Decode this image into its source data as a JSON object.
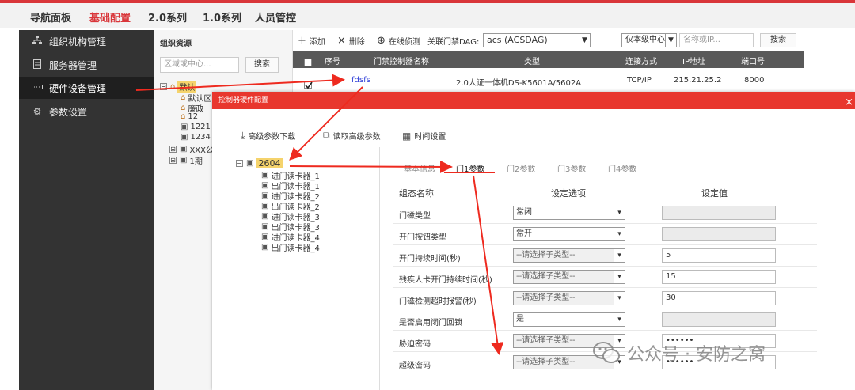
{
  "topnav": {
    "items": [
      {
        "label": "导航面板",
        "active": false
      },
      {
        "label": "基础配置",
        "active": true
      },
      {
        "label": "2.0系列",
        "active": false
      },
      {
        "label": "1.0系列",
        "active": false
      },
      {
        "label": "人员管控",
        "active": false
      }
    ]
  },
  "sidebar": {
    "items": [
      {
        "label": "组织机构管理",
        "icon": "org-chart-icon"
      },
      {
        "label": "服务器管理",
        "icon": "server-icon"
      },
      {
        "label": "硬件设备管理",
        "icon": "hardware-device-icon",
        "active": true
      },
      {
        "label": "参数设置",
        "icon": "gear-icon"
      }
    ]
  },
  "org": {
    "title": "组织资源",
    "search_placeholder": "区域或中心...",
    "search_button": "搜索",
    "tree": [
      {
        "label": "默认",
        "level": 0,
        "expander": "⊟",
        "kind": "home",
        "selected": true
      },
      {
        "label": "默认区",
        "level": 1,
        "kind": "home"
      },
      {
        "label": "廉政",
        "level": 1,
        "kind": "home"
      },
      {
        "label": "12",
        "level": 1,
        "kind": "home"
      },
      {
        "label": "1221",
        "level": 1,
        "kind": "device"
      },
      {
        "label": "1234",
        "level": 1,
        "kind": "device"
      },
      {
        "label": "XXX公",
        "level": 1,
        "expander": "⊞",
        "kind": "device"
      },
      {
        "label": "1期",
        "level": 1,
        "expander": "⊞",
        "kind": "device"
      }
    ]
  },
  "toolbar": {
    "add": "添加",
    "delete": "删除",
    "online_detect": "在线侦测",
    "dag_label": "关联门禁DAG:",
    "dag_value": "acs  (ACSDAG)",
    "scope_value": "仅本级中心",
    "search_placeholder": "名称或IP...",
    "search_button": "搜索"
  },
  "table": {
    "headers": [
      "序号",
      "门禁控制器名称",
      "类型",
      "连接方式",
      "IP地址",
      "端口号"
    ],
    "rows": [
      {
        "name": "fdsfs",
        "type": "2.0人证一体机DS-K5601A/5602A",
        "conn": "TCP/IP",
        "ip": "215.21.25.2",
        "port": "8000"
      }
    ]
  },
  "modal": {
    "title": "控制器硬件配置",
    "close": "×",
    "tools": [
      {
        "label": "高级参数下载",
        "icon": "download-icon"
      },
      {
        "label": "读取高级参数",
        "icon": "read-params-icon"
      },
      {
        "label": "时间设置",
        "icon": "calendar-icon"
      }
    ],
    "tree_root": "2604",
    "tree_children": [
      "进门读卡器_1",
      "出门读卡器_1",
      "进门读卡器_2",
      "出门读卡器_2",
      "进门读卡器_3",
      "出门读卡器_3",
      "进门读卡器_4",
      "出门读卡器_4"
    ],
    "tabs": [
      "基本信息",
      "门1参数",
      "门2参数",
      "门3参数",
      "门4参数"
    ],
    "active_tab": 1,
    "columns": [
      "组态名称",
      "设定选项",
      "设定值"
    ],
    "params": [
      {
        "label": "门磁类型",
        "option": "常闭",
        "value": "",
        "select_disabled": false,
        "value_disabled": true
      },
      {
        "label": "开门按钮类型",
        "option": "常开",
        "value": "",
        "select_disabled": false,
        "value_disabled": true
      },
      {
        "label": "开门持续时间(秒)",
        "option": "--请选择子类型--",
        "value": "5",
        "select_disabled": true,
        "value_disabled": false
      },
      {
        "label": "残疾人卡开门持续时间(秒)",
        "option": "--请选择子类型--",
        "value": "15",
        "select_disabled": true,
        "value_disabled": false
      },
      {
        "label": "门磁检测超时报警(秒)",
        "option": "--请选择子类型--",
        "value": "30",
        "select_disabled": true,
        "value_disabled": false
      },
      {
        "label": "是否启用闭门回锁",
        "option": "是",
        "value": "",
        "select_disabled": false,
        "value_disabled": true
      },
      {
        "label": "胁迫密码",
        "option": "--请选择子类型--",
        "value": "••••••",
        "select_disabled": true,
        "value_disabled": false
      },
      {
        "label": "超级密码",
        "option": "--请选择子类型--",
        "value": "••••••",
        "select_disabled": true,
        "value_disabled": false
      }
    ]
  },
  "watermark": {
    "text": "公众号 · 安防之窝",
    "icon": "wechat-icon"
  },
  "colors": {
    "accent": "#d9363a",
    "modal_header": "#e8372e",
    "sidebar": "#333333",
    "table_header": "#595959"
  }
}
